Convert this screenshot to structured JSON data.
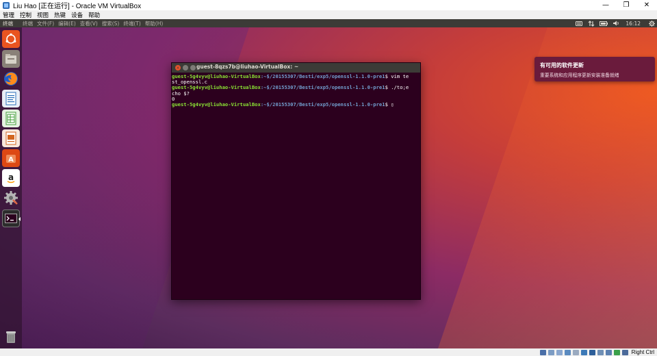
{
  "window": {
    "title": "Liu Hao [正在运行] - Oracle VM VirtualBox",
    "minimize": "—",
    "restore": "❐",
    "close": "✕"
  },
  "vbox_menu": [
    "管理",
    "控制",
    "视图",
    "热键",
    "设备",
    "帮助"
  ],
  "panel": {
    "app_name": "终端",
    "menus": [
      "终端",
      "文件(F)",
      "编辑(E)",
      "查看(V)",
      "搜索(S)",
      "终端(T)",
      "帮助(H)"
    ],
    "clock": "16:12"
  },
  "launcher": {
    "items": [
      {
        "name": "dash-icon",
        "color": "#e95420"
      },
      {
        "name": "files-icon",
        "color": "#a39a8e"
      },
      {
        "name": "firefox-icon",
        "color": "#e66000"
      },
      {
        "name": "writer-icon",
        "color": "#2a6fba"
      },
      {
        "name": "calc-icon",
        "color": "#3f9c35"
      },
      {
        "name": "impress-icon",
        "color": "#d2661f"
      },
      {
        "name": "software-center-icon",
        "color": "#dd4814"
      },
      {
        "name": "amazon-icon",
        "color": "#fff"
      },
      {
        "name": "settings-icon",
        "color": "#c0c0c0"
      },
      {
        "name": "terminal-icon",
        "color": "#2c2c2c"
      }
    ],
    "trash": {
      "name": "trash-icon"
    }
  },
  "terminal": {
    "title": "guest-8qzs7b@liuhao-VirtualBox: ~",
    "lines": [
      {
        "user": "guest-5g4vyv@liuhao-VirtualBox",
        "path": ":~$/20155307/Besti/exp5/openssl-1.1.0-pre1",
        "cmd": "$ vim te"
      },
      {
        "text": "st_openssl.c"
      },
      {
        "user": "guest-5g4vyv@liuhao-VirtualBox",
        "path": ":~$/20155307/Besti/exp5/openssl-1.1.0-pre1",
        "cmd": "$ ./to;e"
      },
      {
        "text": "cho $?"
      },
      {
        "text": "0"
      },
      {
        "user": "guest-5g4vyv@liuhao-VirtualBox",
        "path": ":~$/20155307/Besti/exp5/openssl-1.1.0-pre1",
        "cmd": "$ "
      }
    ]
  },
  "notification": {
    "title": "有可用的软件更新",
    "body": "重要系统和应用程序更新安装准备就绪"
  },
  "status_bar": {
    "host_key": "Right Ctrl"
  },
  "colors": {
    "ubuntu_orange": "#e95420",
    "terminal_bg": "#2c001e",
    "prompt_user": "#8ae234",
    "prompt_path": "#729fcf"
  }
}
